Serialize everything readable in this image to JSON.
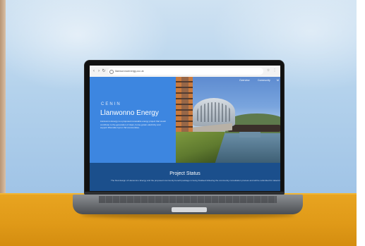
{
  "browser": {
    "url": "llanwonnoenergy.co.uk"
  },
  "site": {
    "nav": [
      "Overview",
      "Community",
      "M"
    ],
    "brand": "CENIN",
    "title": "Llanwonno Energy",
    "description": "Llanwonno Energy is a proposed renewable energy project that would contribute to the generation of clean, home-grown electricity and support Rhondda Cynon Taf communities.",
    "status_title": "Project Status",
    "status_text": "The final design of Llanwonno Energy and the proposed community benefit package is being finalised following the community consultation process and will be submitted for determination."
  },
  "colors": {
    "hero_blue": "#3d86e0",
    "status_blue": "#1b4f8c",
    "table_orange": "#e09a18",
    "wall_blue": "#b4d2ec"
  }
}
